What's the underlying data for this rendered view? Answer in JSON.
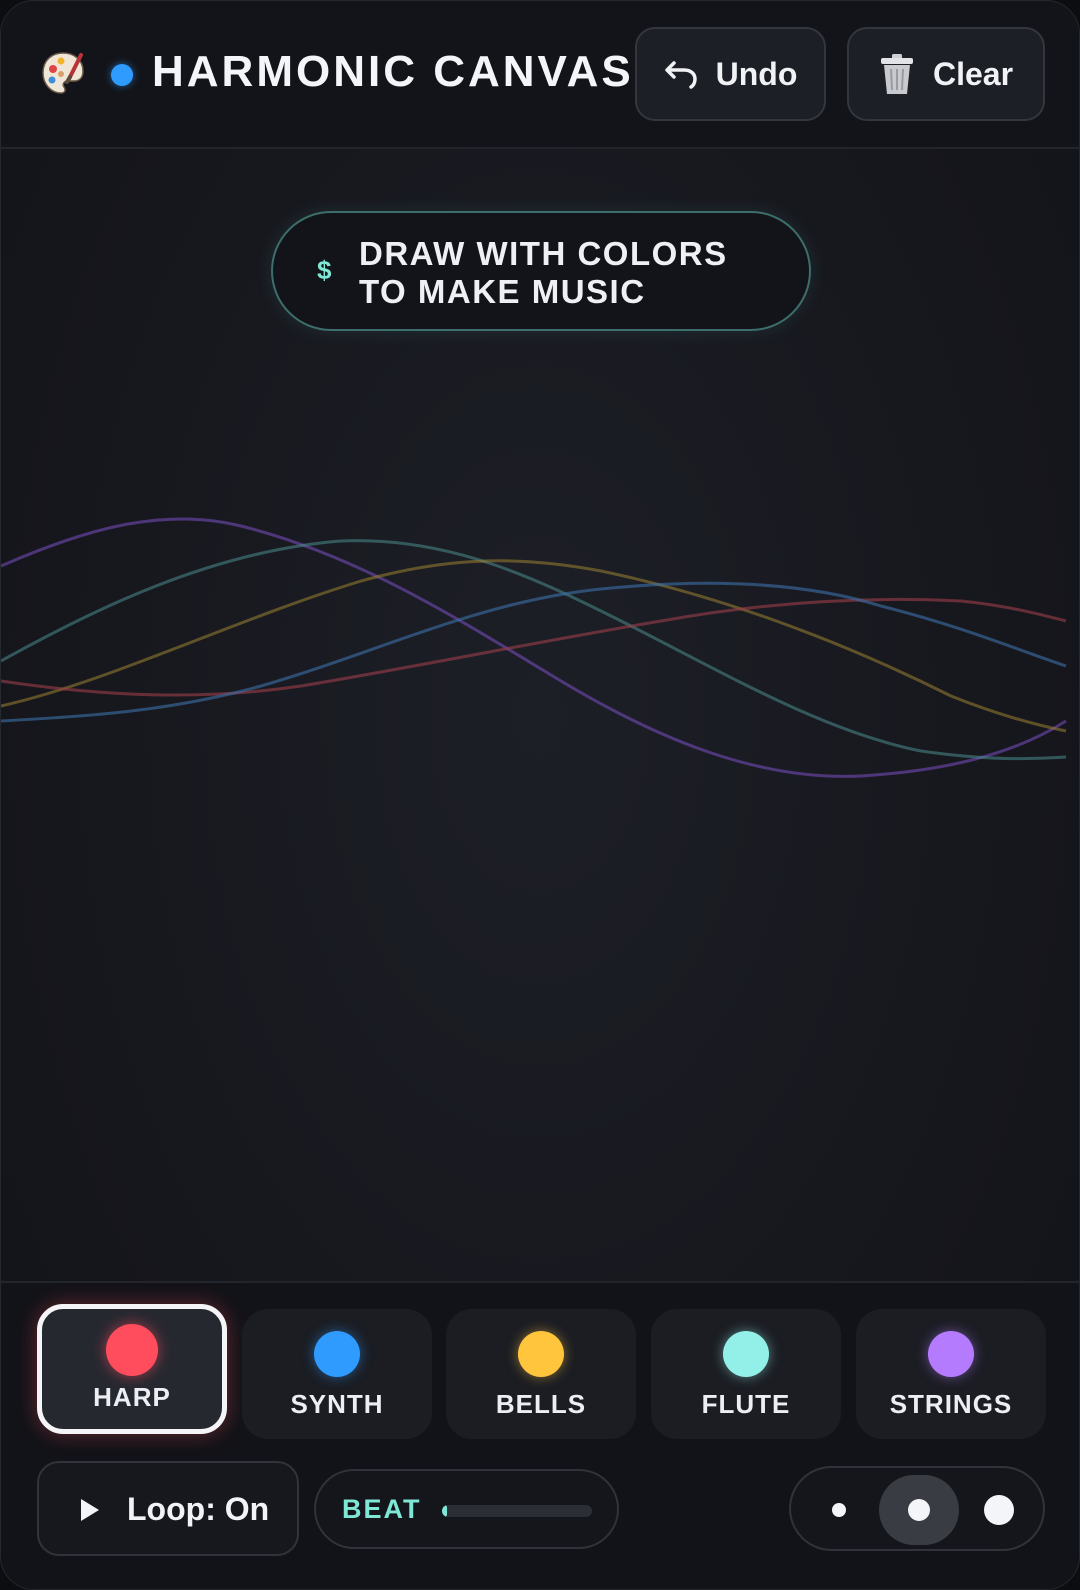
{
  "header": {
    "title": "HARMONIC CANVAS",
    "logo_icon": "palette-icon",
    "status_color": "#2f9bff",
    "undo_label": "Undo",
    "undo_icon": "undo-arrow-icon",
    "clear_label": "Clear",
    "clear_icon": "trash-icon"
  },
  "hint": {
    "icon": "$",
    "line1": "DRAW WITH COLORS",
    "line2": "TO MAKE MUSIC"
  },
  "instruments": [
    {
      "label": "HARP",
      "color": "#ff4d5e",
      "active": true
    },
    {
      "label": "SYNTH",
      "color": "#2f9bff",
      "active": false
    },
    {
      "label": "BELLS",
      "color": "#ffc53d",
      "active": false
    },
    {
      "label": "FLUTE",
      "color": "#93f0e8",
      "active": false
    },
    {
      "label": "STRINGS",
      "color": "#b57bff",
      "active": false
    }
  ],
  "controls": {
    "loop_label": "Loop: On",
    "loop_icon": "play-icon",
    "beat_label": "BEAT",
    "beat_progress": 0.03,
    "brush_sizes": [
      "small",
      "medium",
      "large"
    ],
    "brush_selected": "medium"
  }
}
